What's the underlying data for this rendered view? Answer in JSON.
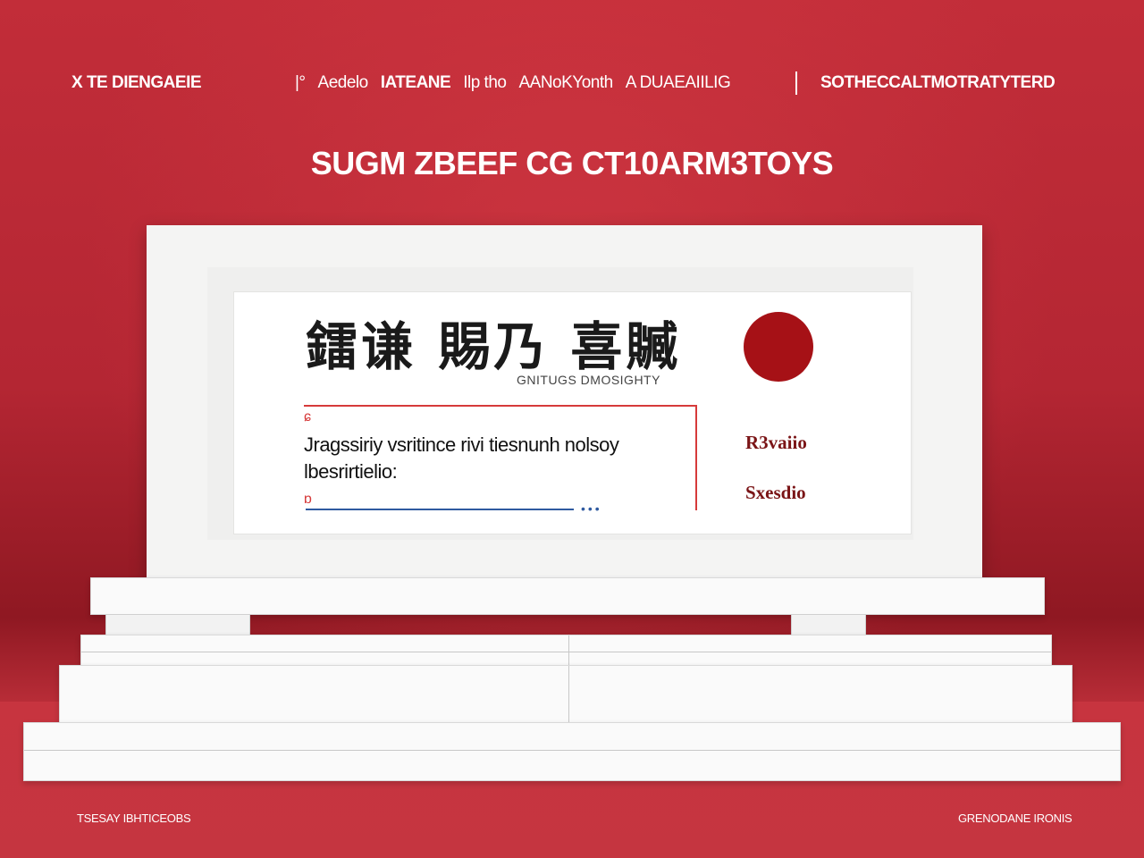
{
  "nav": {
    "left": "X TE DIENGAEIE",
    "middle_items": [
      "|°",
      "Aedelo",
      "IATEANE",
      "Ilp tho",
      "AANoKYonth",
      "A DUAEAIILIG"
    ],
    "right": "SOTHECCALTMOTRATYTERD"
  },
  "headline": "SUGM ZBEEF CG CT10ARM3TOYS",
  "card": {
    "cjk_title": "鐳谦 賜乃 喜贓",
    "subtitle": "GNITUGS DMOSIGHTY",
    "field_text": "Jragssiriy vsritince rivi tiesnunh nolsoy lbesrirtielio:",
    "side_labels": [
      "R3vaiio",
      "Sxesdio"
    ]
  },
  "footer": {
    "left": "TSESAY IBHTICEOBS",
    "right": "GRENODANE IRONIS"
  },
  "colors": {
    "background": "#b92a36",
    "accent_dot": "#a61116",
    "field_border": "#d63a3a",
    "field_underline": "#2f5aa0"
  }
}
